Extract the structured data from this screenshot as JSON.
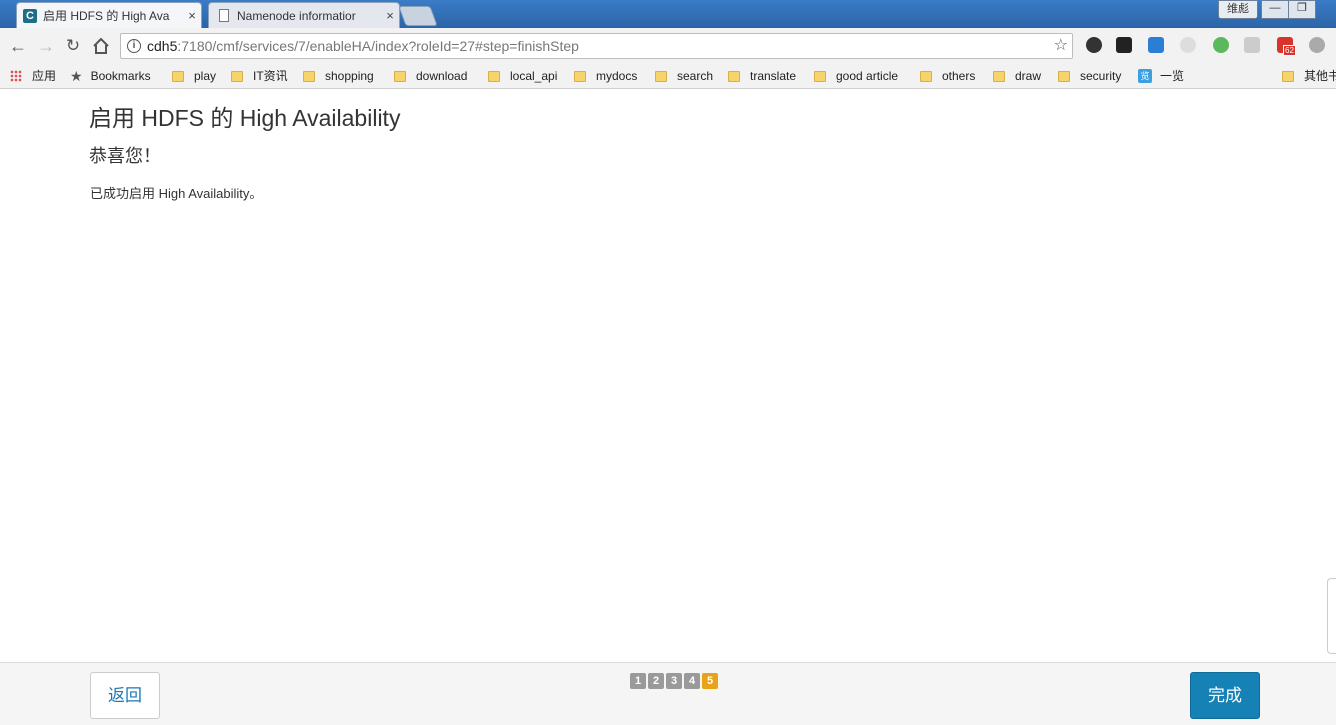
{
  "browser": {
    "tabs": [
      {
        "label": "启用 HDFS 的 High Ava",
        "close": "×"
      },
      {
        "label": "Namenode informatior",
        "close": "×"
      }
    ],
    "window_user": "维彪",
    "window_buttons": {
      "minimize": "—",
      "restore": "❐"
    },
    "address": {
      "host": "cdh5",
      "path": ":7180/cmf/services/7/enableHA/index?roleId=27#step=finishStep"
    },
    "extension_badge": "62",
    "bookmarks": [
      {
        "label": "应用",
        "icon": "apps-grid-icon"
      },
      {
        "label": "Bookmarks",
        "icon": "star-icon"
      },
      {
        "label": "play",
        "icon": "folder-icon"
      },
      {
        "label": "IT资讯",
        "icon": "folder-icon"
      },
      {
        "label": "shopping",
        "icon": "folder-icon"
      },
      {
        "label": "download",
        "icon": "folder-icon"
      },
      {
        "label": "local_api",
        "icon": "folder-icon"
      },
      {
        "label": "mydocs",
        "icon": "folder-icon"
      },
      {
        "label": "search",
        "icon": "folder-icon"
      },
      {
        "label": "translate",
        "icon": "folder-icon"
      },
      {
        "label": "good article",
        "icon": "folder-icon"
      },
      {
        "label": "others",
        "icon": "folder-icon"
      },
      {
        "label": "draw",
        "icon": "folder-icon"
      },
      {
        "label": "security",
        "icon": "folder-icon"
      },
      {
        "label": "一览",
        "icon": "blue-app-icon"
      },
      {
        "label": "其他书",
        "icon": "folder-icon"
      }
    ]
  },
  "page": {
    "title": "启用 HDFS 的 High Availability",
    "subtitle": "恭喜您！",
    "message": "已成功启用 High Availability。"
  },
  "footer": {
    "back_label": "返回",
    "finish_label": "完成",
    "steps": [
      "1",
      "2",
      "3",
      "4",
      "5"
    ],
    "current_step": "5"
  },
  "colors": {
    "accent": "#1581b4",
    "current_step": "#e8a317",
    "inactive_step": "#9a9a9a"
  }
}
